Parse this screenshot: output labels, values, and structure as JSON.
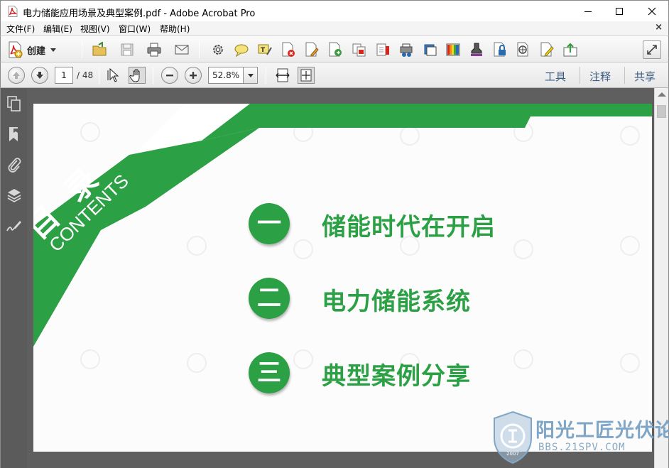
{
  "window": {
    "title": "电力储能应用场景及典型案例.pdf - Adobe Acrobat Pro"
  },
  "menu": {
    "items": [
      "文件(F)",
      "编辑(E)",
      "视图(V)",
      "窗口(W)",
      "帮助(H)"
    ],
    "close_glyph": "×"
  },
  "toolbar": {
    "create_label": "创建",
    "icons": [
      "open-folder-icon",
      "save-icon",
      "print-icon",
      "email-icon",
      "settings-gear-icon",
      "comment-icon",
      "highlight-icon",
      "delete-pdf-icon",
      "edit-pdf-icon",
      "export-pdf-icon",
      "combine-icon",
      "insert-icon",
      "print-production-icon",
      "crop-icon",
      "color-bars-icon",
      "stamp-icon",
      "protect-icon",
      "redact-icon",
      "sign-icon",
      "share-icon"
    ]
  },
  "nav": {
    "page_current": "1",
    "page_total": "/ 48",
    "zoom": "52.8%",
    "right_links": [
      "工具",
      "注释",
      "共享"
    ]
  },
  "sidebar": {
    "icons": [
      "page-thumbnails-icon",
      "bookmarks-icon",
      "attachments-icon",
      "layers-icon",
      "signatures-icon"
    ]
  },
  "slide": {
    "heading_cn": "目 录",
    "heading_en": "CONTENTS",
    "items": [
      {
        "num": "一",
        "text": "储能时代在开启"
      },
      {
        "num": "二",
        "text": "电力储能系统"
      },
      {
        "num": "三",
        "text": "典型案例分享"
      }
    ],
    "accent_color": "#2ca044"
  },
  "watermark": {
    "title": "阳光工匠光伏论坛",
    "url": "BBS.21SPV.COM",
    "badge_text": "2007"
  }
}
